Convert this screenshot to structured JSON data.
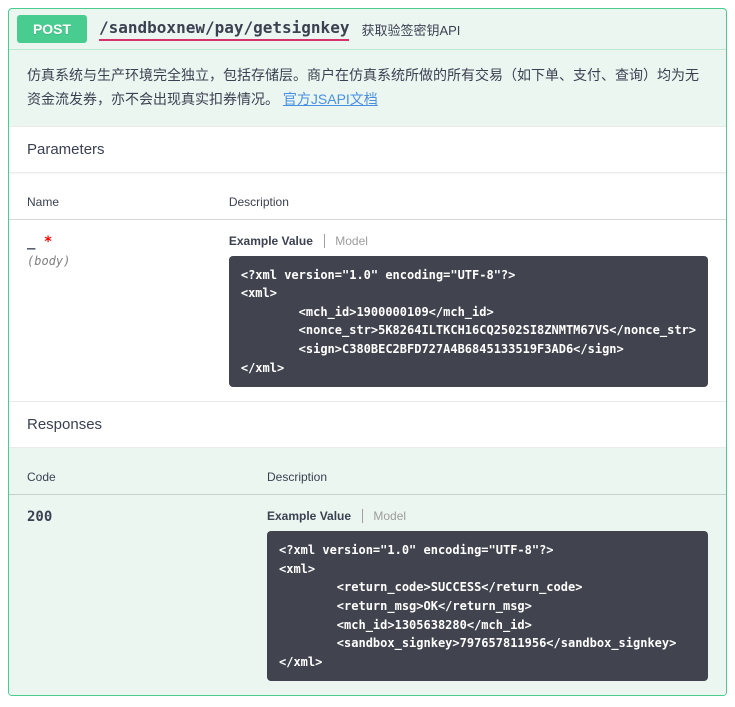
{
  "operation": {
    "method": "POST",
    "path": "/sandboxnew/pay/getsignkey",
    "summary": "获取验签密钥API"
  },
  "description": {
    "text_a": "仿真系统与生产环境完全独立，包括存储层。商户在仿真系统所做的所有交易（如下单、支付、查询）均为无资金流发券，亦不会出现真实扣券情况。",
    "link_label": "官方JSAPI文档"
  },
  "sections": {
    "parameters_title": "Parameters",
    "responses_title": "Responses"
  },
  "headers": {
    "name": "Name",
    "description": "Description",
    "code": "Code"
  },
  "param": {
    "name": "_",
    "required_star": "*",
    "in": "(body)",
    "tab_example": "Example Value",
    "tab_model": "Model",
    "example": "<?xml version=\"1.0\" encoding=\"UTF-8\"?>\n<xml>\n        <mch_id>1900000109</mch_id>\n        <nonce_str>5K8264ILTKCH16CQ2502SI8ZNMTM67VS</nonce_str>\n        <sign>C380BEC2BFD727A4B6845133519F3AD6</sign>\n</xml>"
  },
  "response": {
    "code": "200",
    "tab_example": "Example Value",
    "tab_model": "Model",
    "example": "<?xml version=\"1.0\" encoding=\"UTF-8\"?>\n<xml>\n        <return_code>SUCCESS</return_code>\n        <return_msg>OK</return_msg>\n        <mch_id>1305638280</mch_id>\n        <sandbox_signkey>797657811956</sandbox_signkey>\n</xml>"
  }
}
